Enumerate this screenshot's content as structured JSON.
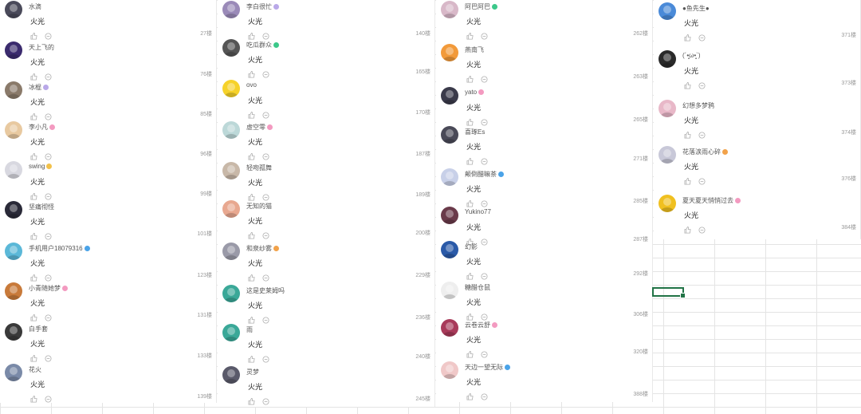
{
  "columns": [
    {
      "comments": [
        {
          "name": "水滴",
          "text": "火光",
          "floor": "27楼",
          "avatar": "#4a4a5a"
        },
        {
          "name": "天上飞的",
          "text": "火光",
          "floor": "76楼",
          "avatar": "#3b2b6e"
        },
        {
          "name": "冰棍",
          "badge": "#b9a8e8",
          "text": "火光",
          "floor": "85楼",
          "avatar": "#8a7a6a"
        },
        {
          "name": "李小凡",
          "badge": "#f39ac0",
          "text": "火光",
          "floor": "96楼",
          "avatar": "#e8c9a0"
        },
        {
          "name": "swing",
          "badge": "#f2c14a",
          "text": "火光",
          "floor": "99楼",
          "avatar": "#d8d8e0"
        },
        {
          "name": "坚痛彻怪",
          "text": "火光",
          "floor": "101楼",
          "avatar": "#2a2a38"
        },
        {
          "name": "手机用户18079316",
          "badge": "#4aa3e8",
          "text": "火光",
          "floor": "123楼",
          "avatar": "#5bb8d8"
        },
        {
          "name": "小青随她梦",
          "badge": "#f39ac0",
          "text": "火光",
          "floor": "131楼",
          "avatar": "#c87a3a"
        },
        {
          "name": "白手套",
          "text": "火光",
          "floor": "133楼",
          "avatar": "#3a3a3a"
        },
        {
          "name": "花火",
          "text": "火光",
          "floor": "139楼",
          "avatar": "#7a8aa8"
        }
      ]
    },
    {
      "comments": [
        {
          "name": "李白很忙",
          "badge": "#b9a8e8",
          "text": "火光",
          "floor": "140楼",
          "avatar": "#9a8ab8"
        },
        {
          "name": "吃瓜群众",
          "badge": "#3cc88a",
          "text": "火光",
          "floor": "165楼",
          "avatar": "#555555"
        },
        {
          "name": "ovo",
          "text": "火光",
          "floor": "170楼",
          "avatar": "#f6d22a"
        },
        {
          "name": "虚空零",
          "badge": "#f39ac0",
          "text": "火光",
          "floor": "187楼",
          "avatar": "#bcd8d8"
        },
        {
          "name": "轻吻孤舞",
          "text": "火光",
          "floor": "189楼",
          "avatar": "#c8b8a8"
        },
        {
          "name": "无知的猫",
          "text": "火光",
          "floor": "200楼",
          "avatar": "#e8a890"
        },
        {
          "name": "和泉纱雾",
          "badge": "#f2a24a",
          "text": "火光",
          "floor": "229楼",
          "avatar": "#9a9aa8"
        },
        {
          "name": "这是史莱姆吗",
          "text": "火光",
          "floor": "236楼",
          "avatar": "#3aa898"
        },
        {
          "name": "雨",
          "text": "火光",
          "floor": "240楼",
          "avatar": "#3aa898"
        },
        {
          "name": "灵梦",
          "text": "火光",
          "floor": "245楼",
          "avatar": "#5a5a6a"
        }
      ]
    },
    {
      "comments": [
        {
          "name": "阿巴阿巴",
          "badge": "#3cc88a",
          "text": "火光",
          "floor": "262楼",
          "avatar": "#d8b8c8"
        },
        {
          "name": "燕南飞",
          "text": "火光",
          "floor": "263楼",
          "avatar": "#f29a3a"
        },
        {
          "name": "yato",
          "badge": "#f39ac0",
          "text": "火光",
          "floor": "265楼",
          "avatar": "#3a3a4a"
        },
        {
          "name": "喜琢Es",
          "text": "火光",
          "floor": "271楼",
          "avatar": "#4a4a58"
        },
        {
          "name": "颠倒醋嘛茶",
          "badge": "#4aa3e8",
          "text": "火光",
          "floor": "285楼",
          "avatar": "#c8d0e8"
        },
        {
          "name": "Yukino77",
          "text": "火光",
          "floor": "287楼",
          "avatar": "#6a3a4a"
        },
        {
          "name": "幻影",
          "text": "火光",
          "floor": "292楼",
          "avatar": "#2a5aa8"
        },
        {
          "name": "糖醋仓鼠",
          "text": "火光",
          "floor": "306楼",
          "avatar": "#eeeeee"
        },
        {
          "name": "云卷云舒",
          "badge": "#f39ac0",
          "text": "火光",
          "floor": "320楼",
          "avatar": "#a83a5a"
        },
        {
          "name": "天边一望无际",
          "badge": "#4aa3e8",
          "text": "火光",
          "floor": "388楼",
          "avatar": "#f0c8c8"
        }
      ]
    },
    {
      "comments": [
        {
          "name": "●鱼先生●",
          "text": "火光",
          "floor": "371楼",
          "avatar": "#4a8ad8"
        },
        {
          "name": "(´•̥̥̥ω•̥̥̥`)",
          "text": "火光",
          "floor": "373楼",
          "avatar": "#2a2a2a"
        },
        {
          "name": "幻想多梦鸦",
          "text": "火光",
          "floor": "374楼",
          "avatar": "#e8b8c8"
        },
        {
          "name": "花落涙雨心碎",
          "badge": "#f2a24a",
          "text": "火光",
          "floor": "376楼",
          "avatar": "#c8c8d8"
        },
        {
          "name": "夏天夏天悄悄过去",
          "badge": "#f39ac0",
          "text": "火光",
          "floor": "384楼",
          "avatar": "#f0c020"
        }
      ]
    }
  ],
  "colors": {
    "selection": "#217346",
    "icon": "#b0b0b0"
  }
}
